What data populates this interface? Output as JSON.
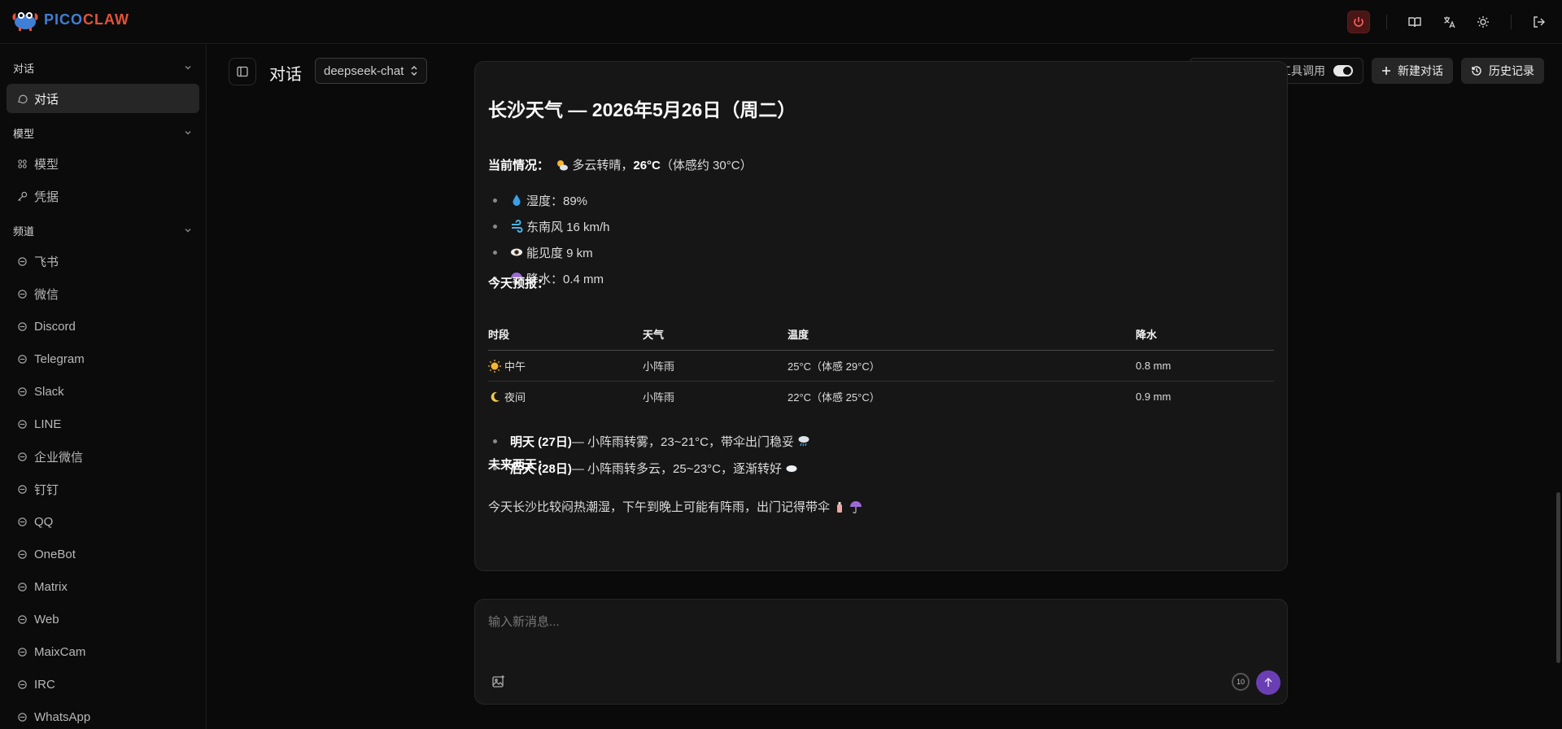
{
  "app": {
    "logo_a": "PICO",
    "logo_b": "CLAW"
  },
  "sidebar": {
    "sections": [
      {
        "title": "对话",
        "items": [
          {
            "label": "对话",
            "icon": "chat-icon",
            "active": true
          }
        ]
      },
      {
        "title": "模型",
        "items": [
          {
            "label": "模型",
            "icon": "grid-icon"
          },
          {
            "label": "凭据",
            "icon": "key-icon"
          }
        ]
      },
      {
        "title": "频道",
        "items": [
          {
            "label": "飞书",
            "icon": "feishu-icon"
          },
          {
            "label": "微信",
            "icon": "wechat-icon"
          },
          {
            "label": "Discord",
            "icon": "discord-icon"
          },
          {
            "label": "Telegram",
            "icon": "telegram-icon"
          },
          {
            "label": "Slack",
            "icon": "slack-icon"
          },
          {
            "label": "LINE",
            "icon": "line-icon"
          },
          {
            "label": "企业微信",
            "icon": "wecom-icon"
          },
          {
            "label": "钉钉",
            "icon": "dingtalk-icon"
          },
          {
            "label": "QQ",
            "icon": "qq-icon"
          },
          {
            "label": "OneBot",
            "icon": "onebot-icon"
          },
          {
            "label": "Matrix",
            "icon": "matrix-icon"
          },
          {
            "label": "Web",
            "icon": "web-icon"
          },
          {
            "label": "MaixCam",
            "icon": "camera-icon"
          },
          {
            "label": "IRC",
            "icon": "irc-icon"
          },
          {
            "label": "WhatsApp",
            "icon": "whatsapp-icon"
          }
        ]
      }
    ]
  },
  "header": {
    "title": "对话",
    "model": "deepseek-chat",
    "toggle_label": "展示思考过程与工具调用",
    "new_chat": "新建对话",
    "history": "历史记录"
  },
  "message": {
    "title": "长沙天气 — 2026年5月26日（周二）",
    "current_label": "当前情况：",
    "current_desc": "多云转晴，",
    "current_temp": "26°C",
    "current_feel": "（体感约 30°C）",
    "bullets": [
      {
        "icon": "droplet-icon",
        "text": "湿度：89%"
      },
      {
        "icon": "wind-icon",
        "text": "东南风 16 km/h"
      },
      {
        "icon": "eye-icon",
        "text": "能见度 9 km"
      },
      {
        "icon": "umbrella-icon",
        "text": "降水：0.4 mm"
      }
    ],
    "today_label": "今天预报：",
    "table": {
      "headers": [
        "时段",
        "天气",
        "温度",
        "降水"
      ],
      "rows": [
        {
          "icon": "sun-icon",
          "period": "中午",
          "weather": "小阵雨",
          "temp": "25°C（体感 29°C）",
          "rain": "0.8 mm"
        },
        {
          "icon": "moon-icon",
          "period": "夜间",
          "weather": "小阵雨",
          "temp": "22°C（体感 25°C）",
          "rain": "0.9 mm"
        }
      ]
    },
    "future_label": "未来两天：",
    "future": [
      {
        "day": "明天 (27日)",
        "text": " — 小阵雨转雾，23~21°C，带伞出门稳妥",
        "icon": "rain-cloud-icon"
      },
      {
        "day": "后天 (28日)",
        "text": " — 小阵雨转多云，25~23°C，逐渐转好",
        "icon": "cloud-icon"
      }
    ],
    "closing": "今天长沙比较闷热潮湿，下午到晚上可能有阵雨，出门记得带伞"
  },
  "composer": {
    "placeholder": "输入新消息...",
    "context_count": "10"
  }
}
